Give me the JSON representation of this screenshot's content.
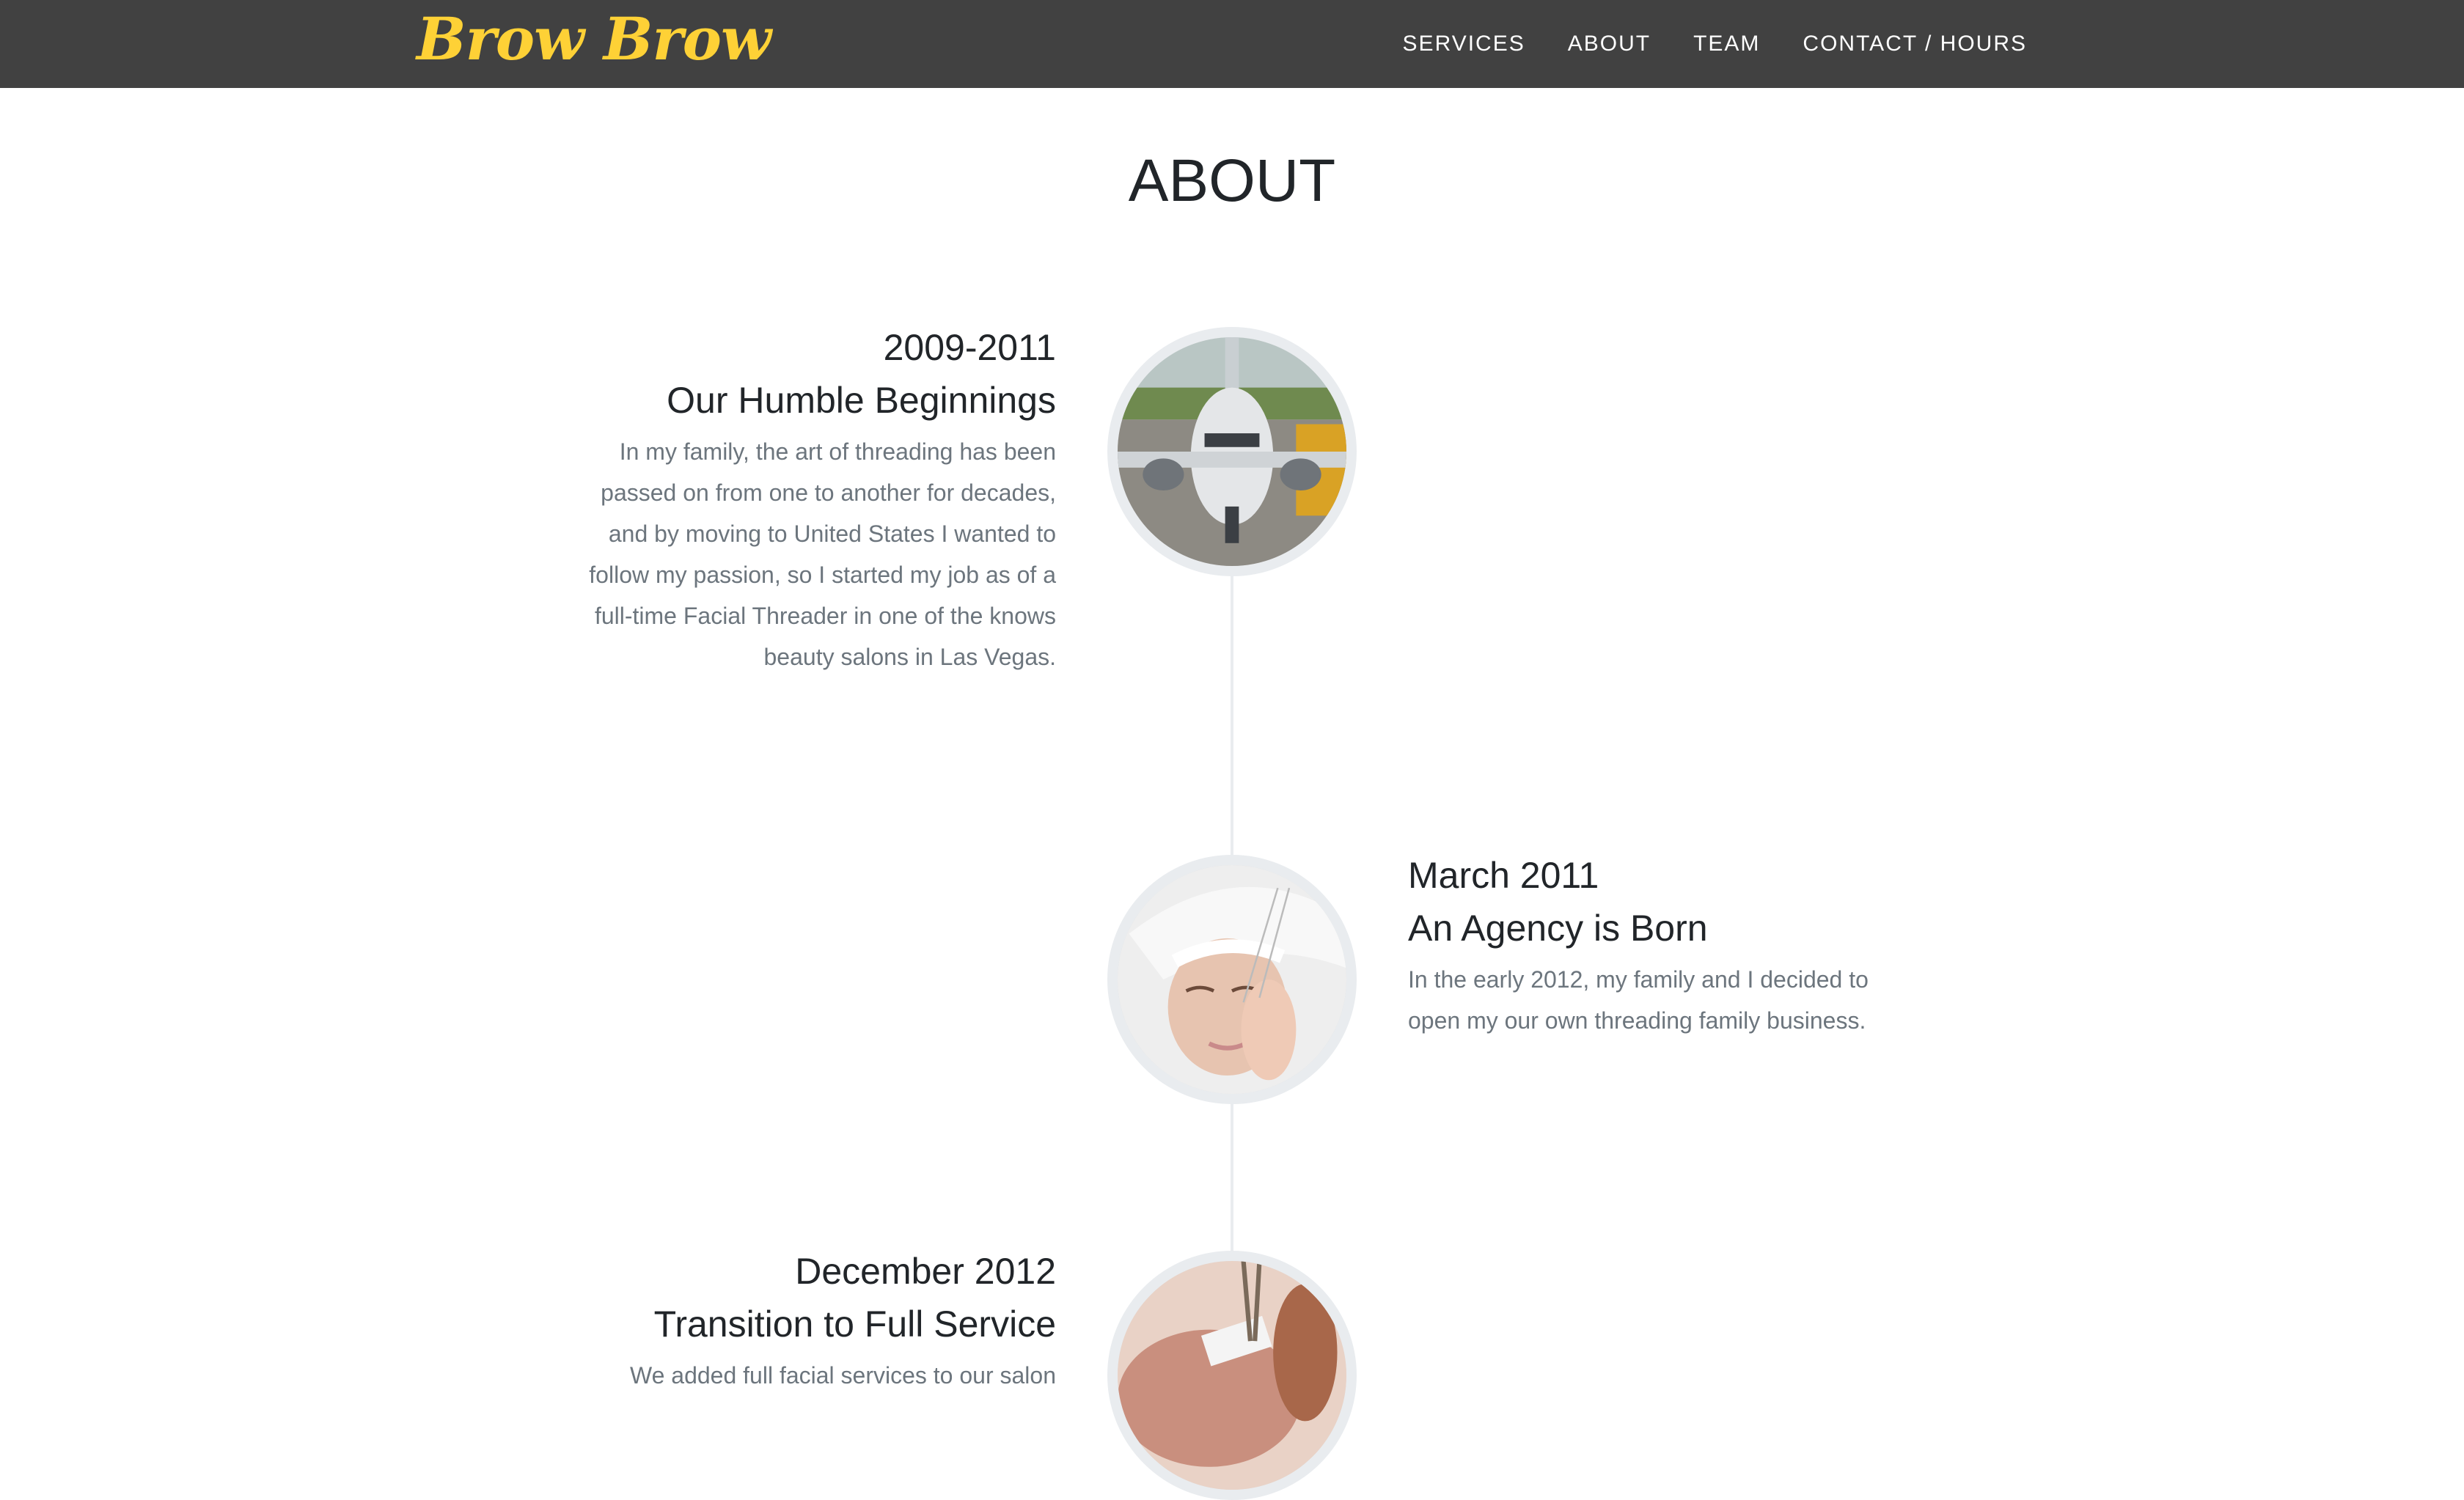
{
  "navbar": {
    "brand": "Brow Brow",
    "links": [
      "SERVICES",
      "ABOUT",
      "TEAM",
      "CONTACT / HOURS"
    ],
    "background_color": "#414141",
    "brand_color": "#fed136"
  },
  "about": {
    "title": "ABOUT",
    "timeline": [
      {
        "date": "2009-2011",
        "heading": "Our Humble Beginnings",
        "body": "In my family, the art of threading has been passed on from one to another for decades, and by moving to United States I wanted to follow my passion, so I started my job as of a full-time Facial Threader in one of the knows beauty salons in Las Vegas.",
        "image": "airplane-photo"
      },
      {
        "date": "March 2011",
        "heading": "An Agency is Born",
        "body": "In the early 2012, my family and I decided to open my our own threading family business.",
        "image": "facial-threading-photo"
      },
      {
        "date": "December 2012",
        "heading": "Transition to Full Service",
        "body": "We added full facial services to our salon",
        "image": "eyebrow-tweezing-photo"
      }
    ]
  }
}
